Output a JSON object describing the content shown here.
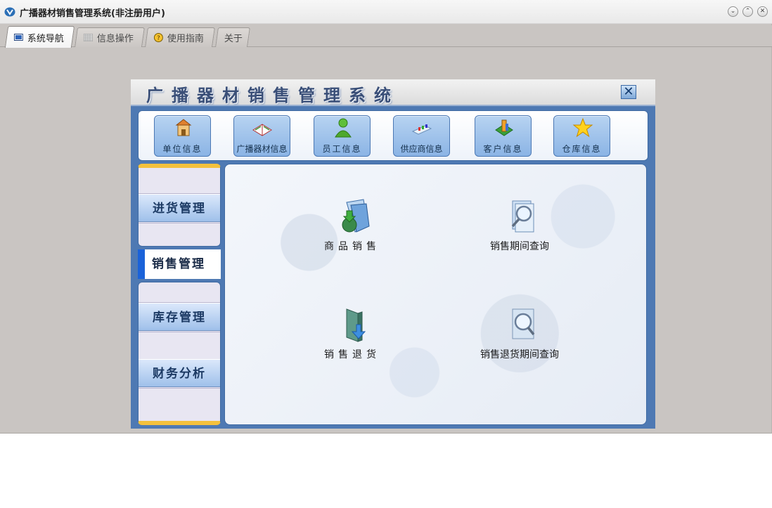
{
  "window": {
    "title": "广播器材销售管理系统(非注册用户)",
    "controls": [
      "minimize",
      "maximize",
      "close"
    ]
  },
  "tabs": [
    {
      "label": "系统导航",
      "icon": "monitor-icon",
      "active": true
    },
    {
      "label": "信息操作",
      "icon": "grid-icon",
      "active": false
    },
    {
      "label": "使用指南",
      "icon": "help-icon",
      "active": false
    },
    {
      "label": "关于",
      "icon": "",
      "active": false
    }
  ],
  "panel": {
    "title": "广播器材销售管理系统",
    "close_label": "✕"
  },
  "toolbar": {
    "items": [
      {
        "label": "单位信息",
        "icon": "building-icon"
      },
      {
        "label": "广播器材信息",
        "icon": "book-icon"
      },
      {
        "label": "员工信息",
        "icon": "person-icon"
      },
      {
        "label": "供应商信息",
        "icon": "supplier-icon"
      },
      {
        "label": "客户信息",
        "icon": "customer-icon"
      },
      {
        "label": "仓库信息",
        "icon": "star-icon"
      }
    ]
  },
  "nav": {
    "items": [
      {
        "label": "进货管理",
        "active": false
      },
      {
        "label": "销售管理",
        "active": true
      },
      {
        "label": "库存管理",
        "active": false
      },
      {
        "label": "财务分析",
        "active": false
      }
    ]
  },
  "functions": [
    {
      "label": "商品销售",
      "icon": "sales-icon"
    },
    {
      "label": "销售期间查询",
      "icon": "query-icon"
    },
    {
      "label": "销售退货",
      "icon": "return-icon"
    },
    {
      "label": "销售退货期间查询",
      "icon": "return-query-icon"
    }
  ],
  "colors": {
    "accent": "#1a62d9",
    "panel_blue": "#4e79b3",
    "nav_stripe": "#f4c13c"
  }
}
